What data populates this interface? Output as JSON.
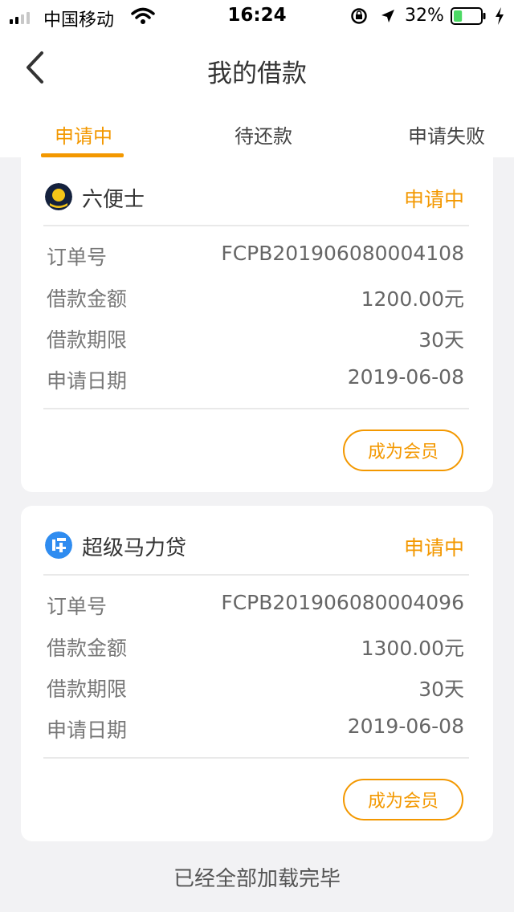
{
  "status_bar": {
    "carrier": "中国移动",
    "time": "16:24",
    "battery_percent": "32%",
    "battery_level": 0.32,
    "icons": [
      "signal-icon",
      "wifi-icon",
      "rotation-lock-icon",
      "location-arrow-icon",
      "battery-icon",
      "charging-icon"
    ]
  },
  "nav": {
    "title": "我的借款",
    "back_icon": "chevron-left-icon"
  },
  "tabs": [
    {
      "label": "申请中",
      "active": true
    },
    {
      "label": "待还款",
      "active": false
    },
    {
      "label": "申请失败",
      "active": false
    }
  ],
  "loans": [
    {
      "lender": "六便士",
      "status": "申请中",
      "rows": [
        {
          "label": "订单号",
          "value": "FCPB201906080004108"
        },
        {
          "label": "借款金额",
          "value": "1200.00元"
        },
        {
          "label": "借款期限",
          "value": "30天"
        },
        {
          "label": "申请日期",
          "value": "2019-06-08"
        }
      ],
      "action_label": "成为会员"
    },
    {
      "lender": "超级马力贷",
      "status": "申请中",
      "rows": [
        {
          "label": "订单号",
          "value": "FCPB201906080004096"
        },
        {
          "label": "借款金额",
          "value": "1300.00元"
        },
        {
          "label": "借款期限",
          "value": "30天"
        },
        {
          "label": "申请日期",
          "value": "2019-06-08"
        }
      ],
      "action_label": "成为会员"
    }
  ],
  "footer": {
    "message": "已经全部加载完毕"
  },
  "colors": {
    "accent": "#f39800",
    "background": "#f2f2f4",
    "card": "#ffffff"
  }
}
